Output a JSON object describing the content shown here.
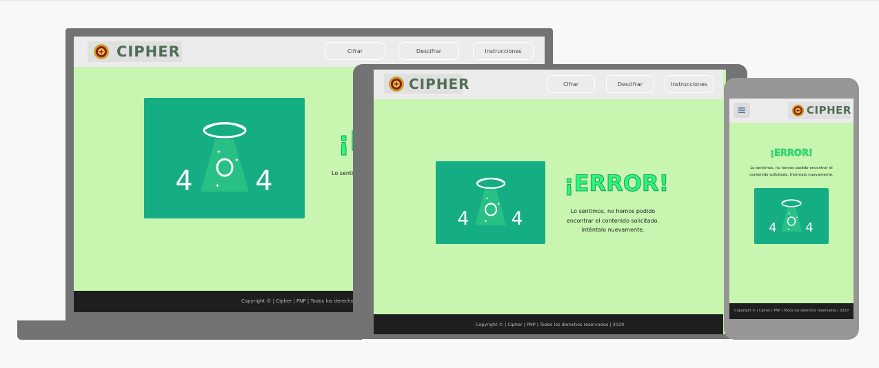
{
  "brand": {
    "name": "CIPHER"
  },
  "nav": {
    "cifrar": "Cifrar",
    "descifrar": "Descifrar",
    "instrucciones": "Instrucciones"
  },
  "error": {
    "title": "¡ERROR!",
    "message_full": "Lo sentimos, no hemos podido encontrar el contenido solicitado. Inténtalo nuevamente.",
    "laptop_visible_message": "Lo sentim",
    "tablet_lines": [
      "Lo sentimos, no hemos podido",
      "encontrar el contenido solicitado.",
      "Inténtalo nuevamente."
    ],
    "phone_lines": [
      "Lo sentimos, no hemos podido encontrar el",
      "contenido solicitado. Inténtalo nuevamente."
    ],
    "code_left": "4",
    "code_right": "4"
  },
  "footer": {
    "text": "Copyright © | Cipher | PNP | Todos los derechos reservados | 2020",
    "laptop_visible": "Copyright © | Cipher | PNP | Todos los derechos reservado"
  },
  "colors": {
    "page_bg": "#c8f5b0",
    "art_bg": "#15ad84",
    "error_text": "#2ef57a",
    "footer_bg": "#1e1e1e",
    "device": "#737373"
  },
  "icons": {
    "menu": "hamburger-icon",
    "emblem": "police-emblem-icon",
    "art": "ufo-abduction-icon"
  }
}
